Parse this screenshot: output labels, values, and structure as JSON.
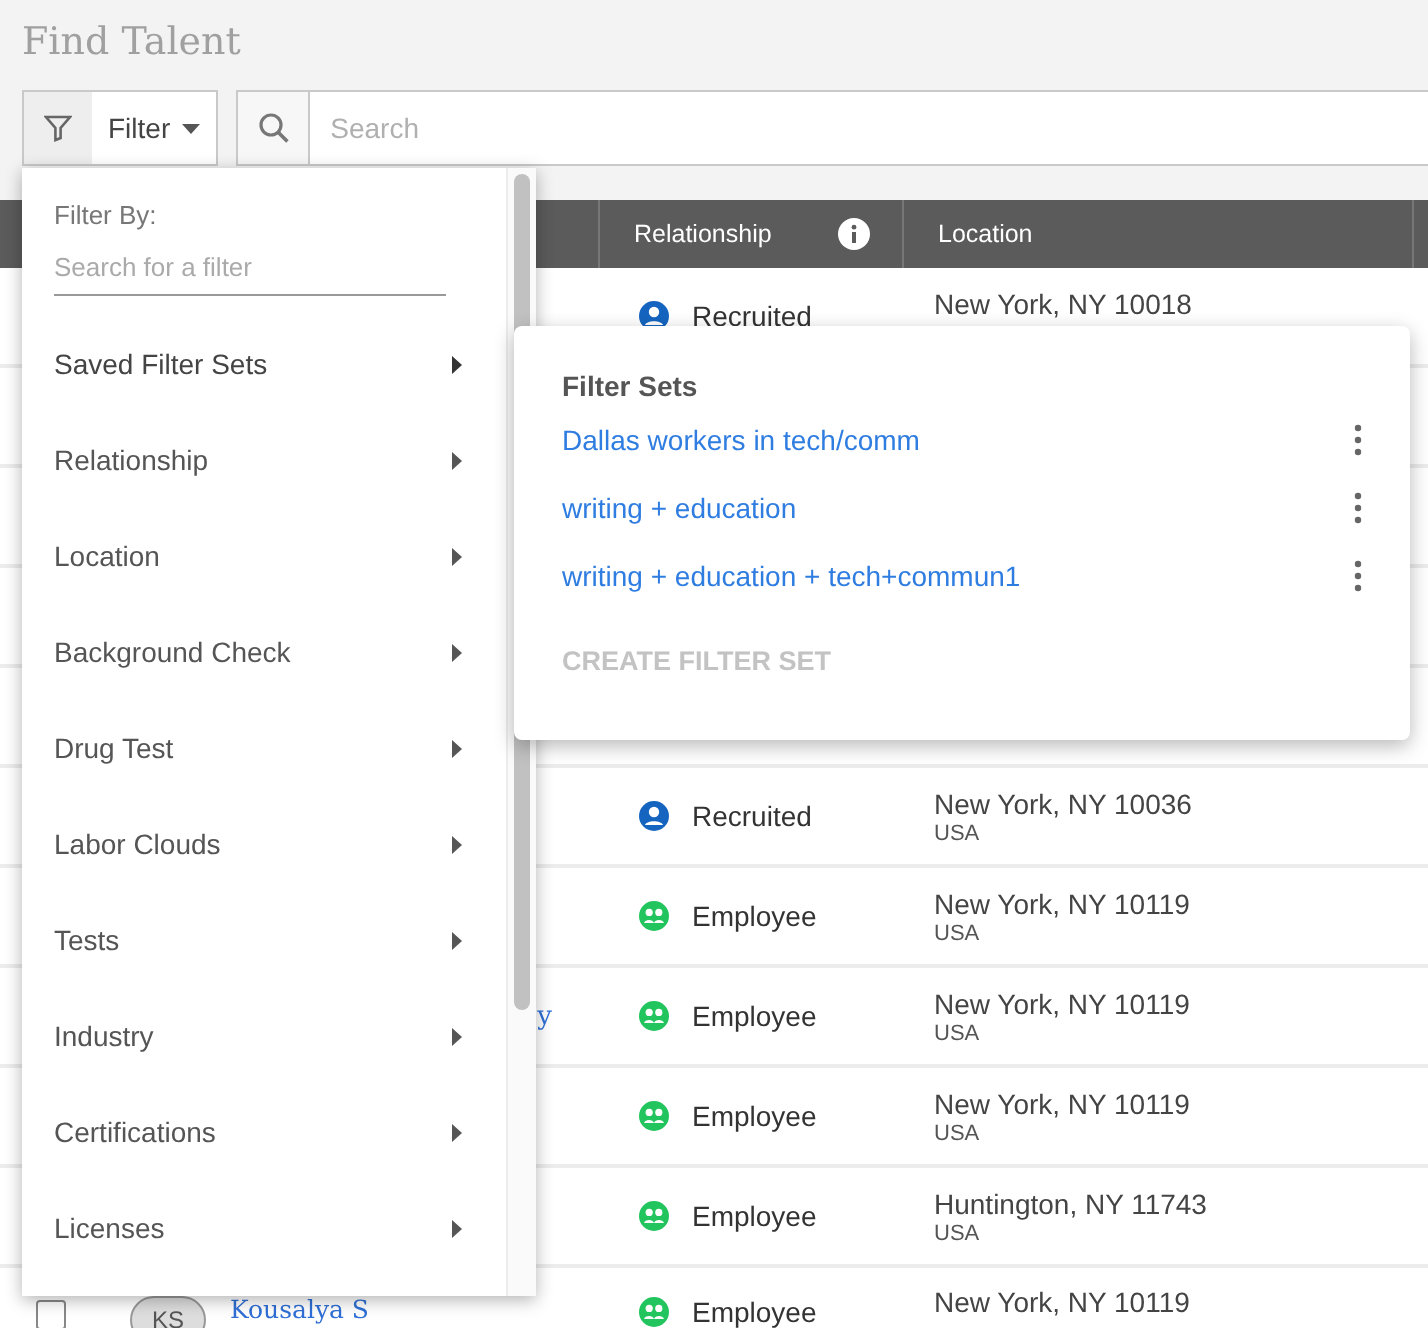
{
  "page": {
    "title": "Find Talent"
  },
  "toolbar": {
    "filter_button": {
      "label": "Filter"
    },
    "search": {
      "placeholder": "Search"
    }
  },
  "table": {
    "columns": [
      {
        "label": "Relationship",
        "info": true
      },
      {
        "label": "Location",
        "info": false
      }
    ],
    "rows": [
      {
        "relationship": {
          "kind": "recruited",
          "label": "Recruited"
        },
        "location": "New York, NY 10018"
      },
      {},
      {},
      {},
      {},
      {
        "relationship": {
          "kind": "recruited",
          "label": "Recruited"
        },
        "location": "New York, NY 10036",
        "country": "USA"
      },
      {
        "relationship": {
          "kind": "employee",
          "label": "Employee"
        },
        "location": "New York, NY 10119",
        "country": "USA"
      },
      {
        "name": "y",
        "name_cut": true,
        "relationship": {
          "kind": "employee",
          "label": "Employee"
        },
        "location": "New York, NY 10119",
        "country": "USA"
      },
      {
        "relationship": {
          "kind": "employee",
          "label": "Employee"
        },
        "location": "New York, NY 10119",
        "country": "USA"
      },
      {
        "relationship": {
          "kind": "employee",
          "label": "Employee"
        },
        "location": "Huntington, NY 11743",
        "country": "USA"
      },
      {
        "checked": false,
        "initials": "KS",
        "name": "Kousalya S",
        "relationship": {
          "kind": "employee",
          "label": "Employee"
        },
        "location": "New York, NY 10119"
      }
    ]
  },
  "filter_menu": {
    "heading": "Filter By:",
    "search": {
      "placeholder": "Search for a filter"
    },
    "items": [
      {
        "label": "Saved Filter Sets",
        "expanded": true
      },
      {
        "label": "Relationship",
        "expanded": false
      },
      {
        "label": "Location",
        "expanded": false
      },
      {
        "label": "Background Check",
        "expanded": false
      },
      {
        "label": "Drug Test",
        "expanded": false
      },
      {
        "label": "Labor Clouds",
        "expanded": false
      },
      {
        "label": "Tests",
        "expanded": false
      },
      {
        "label": "Industry",
        "expanded": false
      },
      {
        "label": "Certifications",
        "expanded": false
      },
      {
        "label": "Licenses",
        "expanded": false
      }
    ]
  },
  "filter_sets": {
    "heading": "Filter Sets",
    "items": [
      {
        "label": "Dallas workers in tech/comm"
      },
      {
        "label": "writing + education"
      },
      {
        "label": "writing + education + tech+commun1"
      }
    ],
    "create_button": {
      "label": "CREATE FILTER SET",
      "disabled": true
    }
  }
}
